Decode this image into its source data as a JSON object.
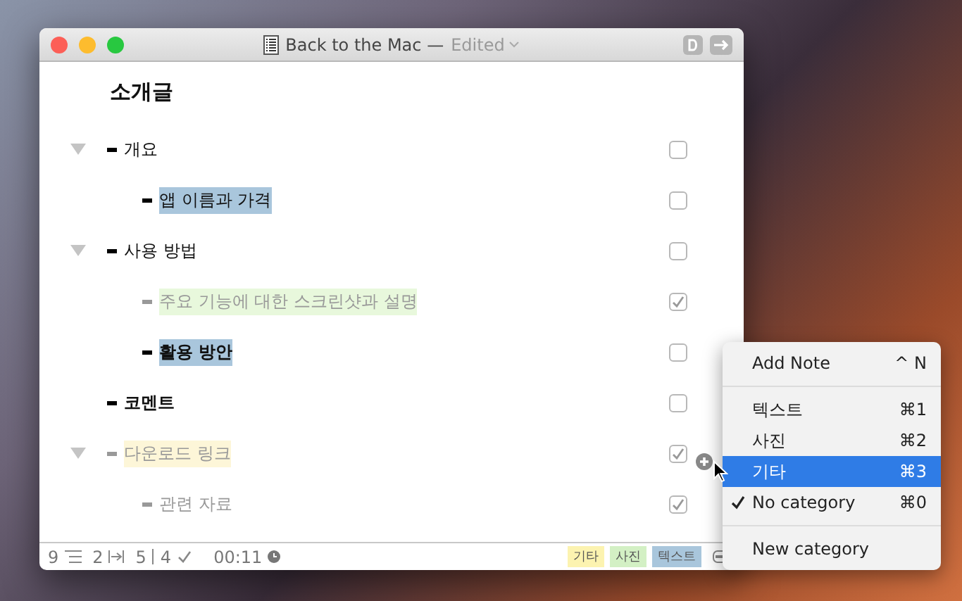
{
  "window": {
    "title": "Back to the Mac",
    "separator": "—",
    "edited": "Edited"
  },
  "document": {
    "title": "소개글"
  },
  "items": [
    {
      "text": "개요",
      "bold": false,
      "checked": false,
      "done": false,
      "expanded": true,
      "children": [
        {
          "text": "앱 이름과 가격",
          "bold": false,
          "checked": false,
          "done": false,
          "color": "#a9c6dc"
        }
      ]
    },
    {
      "text": "사용 방법",
      "bold": false,
      "checked": false,
      "done": false,
      "expanded": true,
      "children": [
        {
          "text": "주요 기능에 대한 스크린샷과 설명",
          "bold": false,
          "checked": true,
          "done": true,
          "color": "#e8f8dc"
        },
        {
          "text": "활용 방안",
          "bold": true,
          "checked": false,
          "done": false,
          "color": "#a9c6dc"
        }
      ]
    },
    {
      "text": "코멘트",
      "bold": true,
      "checked": false,
      "done": false
    },
    {
      "text": "다운로드 링크",
      "bold": false,
      "checked": true,
      "done": true,
      "expanded": true,
      "color": "#fdf6d8",
      "children": [
        {
          "text": "관련 자료",
          "bold": false,
          "checked": true,
          "done": true
        }
      ]
    }
  ],
  "status_bar": {
    "items_count": "9",
    "level_count": "2",
    "total": "5",
    "done": "4",
    "time": "00:11",
    "tags": [
      {
        "label": "기타",
        "color": "#fcf3b0"
      },
      {
        "label": "사진",
        "color": "#d3f0c4"
      },
      {
        "label": "텍스트",
        "color": "#a9c6dc"
      }
    ]
  },
  "menu": [
    {
      "kind": "item",
      "label": "Add Note",
      "shortcut": "^ N",
      "selected": false,
      "checked": false
    },
    {
      "kind": "separator"
    },
    {
      "kind": "item",
      "label": "텍스트",
      "shortcut": "⌘1",
      "selected": false,
      "checked": false
    },
    {
      "kind": "item",
      "label": "사진",
      "shortcut": "⌘2",
      "selected": false,
      "checked": false
    },
    {
      "kind": "item",
      "label": "기타",
      "shortcut": "⌘3",
      "selected": true,
      "checked": false
    },
    {
      "kind": "item",
      "label": "No category",
      "shortcut": "⌘0",
      "selected": false,
      "checked": true
    },
    {
      "kind": "separator"
    },
    {
      "kind": "item",
      "label": "New category",
      "selected": false,
      "checked": false
    }
  ]
}
